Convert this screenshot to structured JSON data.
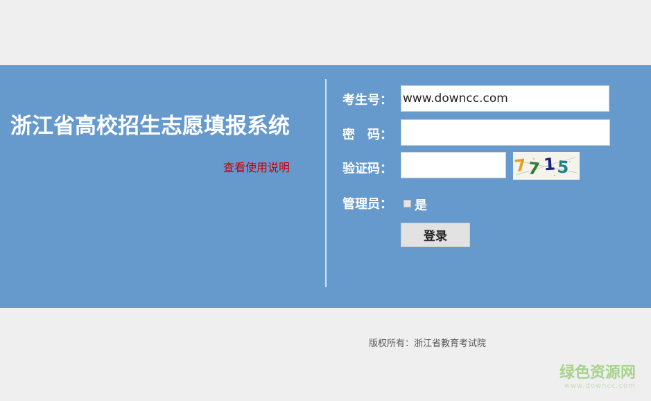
{
  "header": {
    "system_title": "浙江省高校招生志愿填报系统",
    "help_link": "查看使用说明"
  },
  "form": {
    "exam_id_label": "考生号：",
    "exam_id_value": "www.downcc.com",
    "password_label": "密　码：",
    "password_value": "",
    "captcha_label": "验证码：",
    "captcha_value": "",
    "captcha_image": {
      "chars": [
        "7",
        "7",
        "1",
        "5"
      ],
      "colors": [
        "#e3a020",
        "#2e7d32",
        "#1a237e",
        "#1e7e8c"
      ]
    },
    "admin_label": "管理员：",
    "admin_checkbox_label": "是",
    "admin_checked": false,
    "login_button": "登录"
  },
  "footer": {
    "copyright": "版权所有：浙江省教育考试院"
  },
  "watermark": {
    "text": "绿色资源网",
    "url": "www.downcc.com"
  },
  "colors": {
    "band": "#6699cc",
    "page_background": "#efefef",
    "help_link": "#cc0000"
  }
}
